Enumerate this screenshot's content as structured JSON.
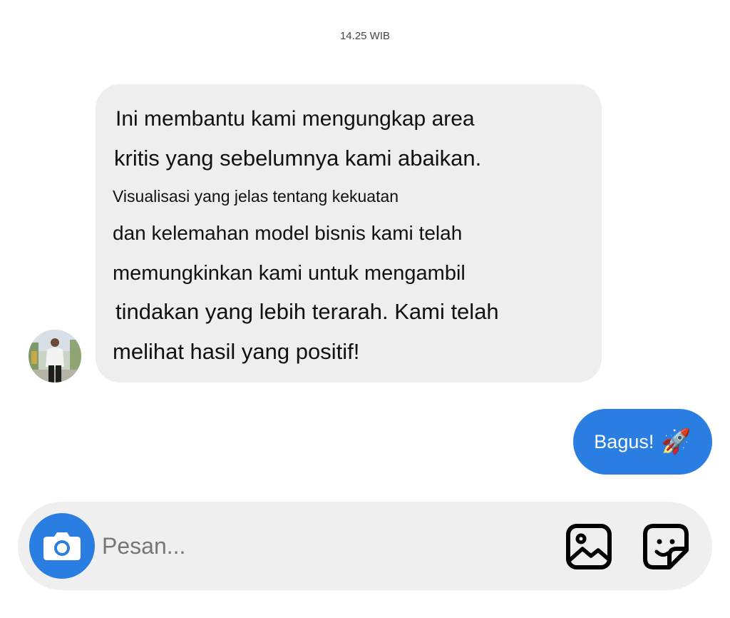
{
  "timestamp": "14.25 WIB",
  "incoming_message": {
    "lines": [
      "Ini membantu kami mengungkap area",
      "kritis yang sebelumnya kami abaikan.",
      "Visualisasi yang jelas tentang kekuatan",
      "dan kelemahan model bisnis kami telah",
      "memungkinkan kami untuk mengambil",
      "tindakan yang lebih terarah. Kami telah",
      "melihat hasil yang positif!"
    ]
  },
  "outgoing_message": {
    "text": "Bagus!",
    "emoji": "🚀"
  },
  "composer": {
    "placeholder": "Pesan...",
    "camera_icon": "camera-icon",
    "gallery_icon": "image-icon",
    "sticker_icon": "sticker-icon"
  },
  "colors": {
    "accent": "#2a7de1",
    "incoming_bubble": "#eeeeee",
    "composer_bg": "#efefef"
  }
}
